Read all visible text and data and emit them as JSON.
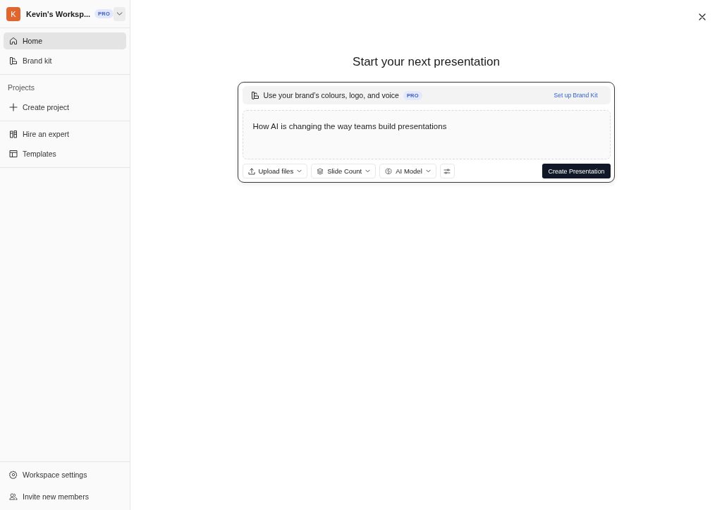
{
  "sidebar": {
    "workspace": {
      "initial": "K",
      "name": "Kevin's Worksp...",
      "badge": "PRO"
    },
    "sections": [
      {
        "items": [
          {
            "label": "Home",
            "selected": true
          },
          {
            "label": "Brand kit",
            "selected": false
          }
        ]
      },
      {
        "heading": "Projects",
        "items": [
          {
            "label": "Create project",
            "selected": false
          }
        ]
      },
      {
        "items": [
          {
            "label": "Hire an expert",
            "selected": false
          },
          {
            "label": "Templates",
            "selected": false
          }
        ]
      }
    ],
    "footer": [
      {
        "label": "Workspace settings",
        "selected": false
      },
      {
        "label": "Invite new members",
        "selected": false
      }
    ]
  },
  "main": {
    "title": "Start your next presentation",
    "prompt_card": {
      "brand_bar": {
        "text": "Use your brand’s colours, logo, and voice",
        "badge": "PRO",
        "link": "Set up Brand Kit"
      },
      "prompt": {
        "value": "How AI is changing the way teams build presentations"
      },
      "toolbar": [
        {
          "kind": "dropdown",
          "label": "Upload files"
        },
        {
          "kind": "dropdown",
          "label": "Slide Count"
        },
        {
          "kind": "dropdown",
          "label": "AI Model"
        },
        {
          "kind": "icon"
        }
      ],
      "submit": "Create Presentation"
    }
  }
}
